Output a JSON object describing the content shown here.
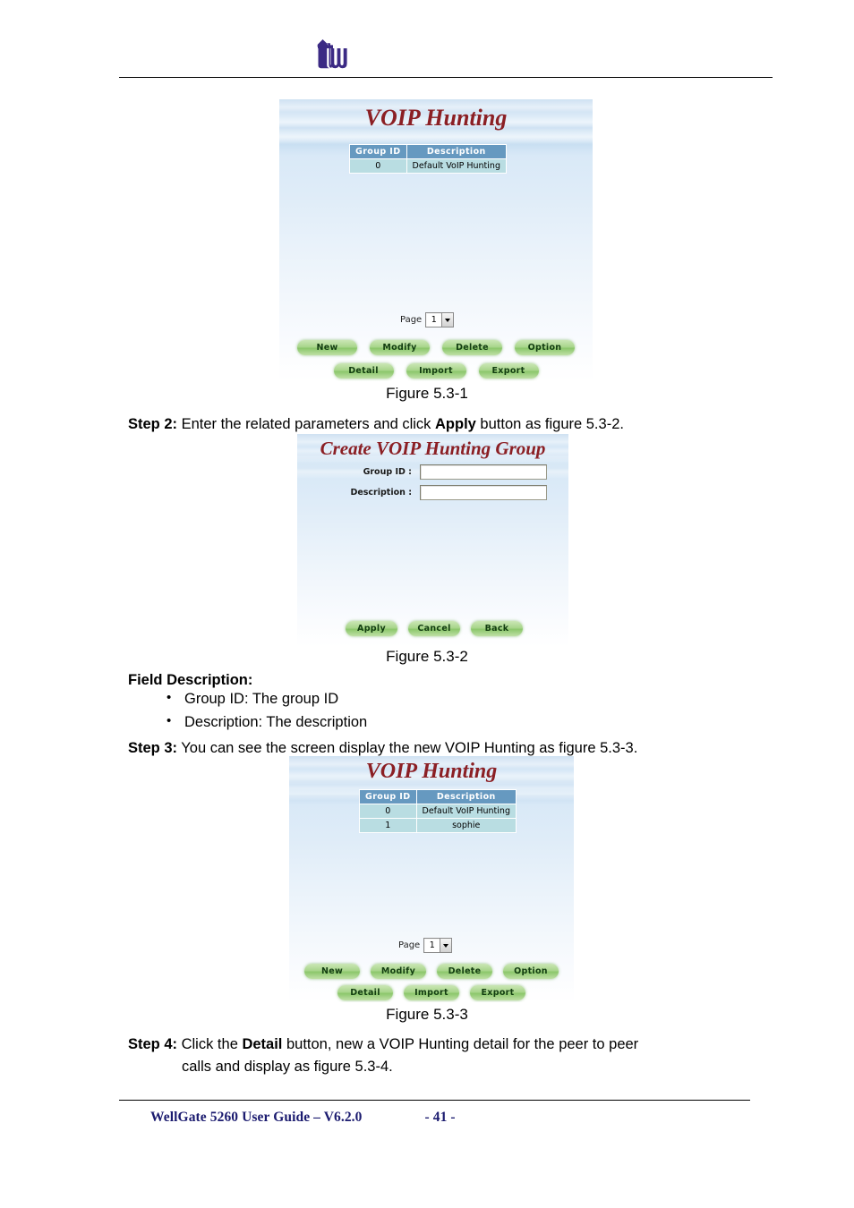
{
  "header": {
    "logo_icon": "tw-company-logo"
  },
  "footer": {
    "doc_title": "WellGate 5260 User Guide – V6.2.0",
    "page_number": "- 41 -"
  },
  "figures": [
    {
      "id": "figure-5-3-1",
      "caption": "Figure 5.3-1",
      "panel_title": "VOIP Hunting",
      "table": {
        "columns": [
          "Group ID",
          "Description"
        ],
        "rows": [
          [
            "0",
            "Default VoIP Hunting"
          ]
        ]
      },
      "page_selector": {
        "label": "Page",
        "value": "1"
      },
      "buttons_row1": [
        "New",
        "Modify",
        "Delete",
        "Option"
      ],
      "buttons_row2": [
        "Detail",
        "Import",
        "Export"
      ]
    },
    {
      "id": "figure-5-3-2",
      "caption": "Figure 5.3-2",
      "panel_title": "Create VOIP Hunting Group",
      "fields": [
        {
          "label": "Group ID :",
          "value": "",
          "placeholder": ""
        },
        {
          "label": "Description :",
          "value": "",
          "placeholder": ""
        }
      ],
      "buttons_row1": [
        "Apply",
        "Cancel",
        "Back"
      ]
    },
    {
      "id": "figure-5-3-3",
      "caption": "Figure 5.3-3",
      "panel_title": "VOIP Hunting",
      "table": {
        "columns": [
          "Group ID",
          "Description"
        ],
        "rows": [
          [
            "0",
            "Default VoIP Hunting"
          ],
          [
            "1",
            "sophie"
          ]
        ]
      },
      "page_selector": {
        "label": "Page",
        "value": "1"
      },
      "buttons_row1": [
        "New",
        "Modify",
        "Delete",
        "Option"
      ],
      "buttons_row2": [
        "Detail",
        "Import",
        "Export"
      ]
    }
  ],
  "steps": {
    "step2": {
      "label": "Step 2:",
      "text_before": " Enter the related parameters and click ",
      "emphasis": "Apply",
      "text_after": " button as figure 5.3-2."
    },
    "step3": {
      "label": "Step 3:",
      "text": " You can see the screen display the new VOIP Hunting as figure 5.3-3."
    },
    "step4": {
      "label": "Step 4:",
      "text_before": " Click the ",
      "emphasis": "Detail",
      "text_after": " button, new a VOIP Hunting detail for the peer to peer",
      "line2": "calls and display as figure 5.3-4."
    }
  },
  "field_description": {
    "heading": "Field Description:",
    "items": [
      "Group ID: The group ID",
      "Description: The description"
    ]
  },
  "colors": {
    "title_red": "#8b1f24",
    "table_header_blue": "#6699c0",
    "table_cell_cyan": "#b9dde2",
    "button_green": "#a9d68c",
    "footer_navy": "#1b1b6f",
    "logo_purple": "#3b2a84"
  }
}
